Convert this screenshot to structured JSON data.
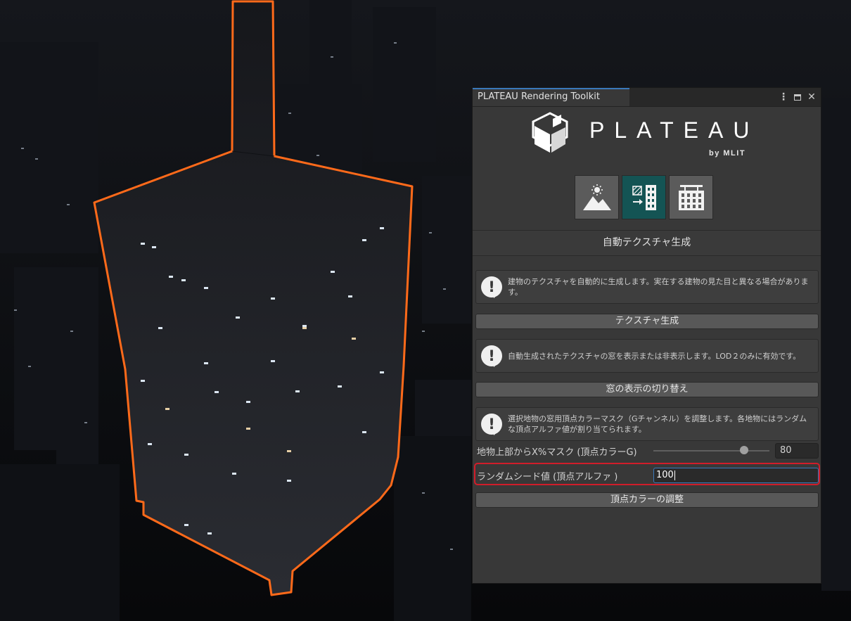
{
  "panel": {
    "window_title": "PLATEAU Rendering Toolkit",
    "logo": {
      "name": "PLATEAU",
      "tagline": "by MLIT"
    },
    "mode_buttons": [
      {
        "icon": "landscape-sun-icon",
        "active": false
      },
      {
        "icon": "building-texture-icon",
        "active": true
      },
      {
        "icon": "building-icon",
        "active": false
      }
    ],
    "section_title": "自動テクスチャ生成",
    "help1": "建物のテクスチャを自動的に生成します。実在する建物の見た目と異なる場合があります。",
    "button_generate": "テクスチャ生成",
    "help2": "自動生成されたテクスチャの窓を表示または非表示します。LOD２のみに有効です。",
    "button_window_toggle": "窓の表示の切り替え",
    "help3": "選択地物の窓用頂点カラーマスク（Gチャンネル）を調整します。各地物にはランダムな頂点アルファ値が割り当てられます。",
    "mask_label": "地物上部からX%マスク (頂点カラーG)",
    "mask_value": "80",
    "seed_label": "ランダムシード値 (頂点アルファ )",
    "seed_value": "100",
    "button_adjust": "頂点カラーの調整"
  },
  "colors": {
    "accent_selection": "#ff6a1a",
    "active_tab": "#3a79bb",
    "active_mode": "#145454",
    "highlight_frame": "#d11d2a"
  }
}
